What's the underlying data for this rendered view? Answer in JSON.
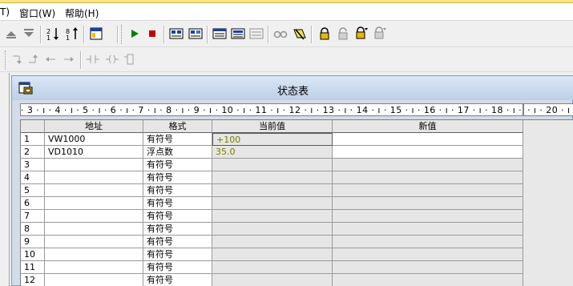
{
  "menu": {
    "items": [
      {
        "label": "T)"
      },
      {
        "label": "窗口(W)"
      },
      {
        "label": "帮助(H)"
      }
    ]
  },
  "status_window": {
    "title": "状态表",
    "ruler_text": "· 3 · ı · 4 · ı · 5 · ı · 6 · ı · 7 · ı · 8 · ı · 9 · ı · 10 · ı · 11 · ı · 12 · ı · 13 · ı · 14 · ı · 15 · ı · 16 · ı · 17 · ı · 18 · ı ·",
    "ruler_text_right": "· ı · 20 · ı",
    "columns": [
      "地址",
      "格式",
      "当前值",
      "新值"
    ],
    "rows": [
      {
        "num": "1",
        "address": "VW1000",
        "format": "有符号",
        "current": "+100",
        "new": ""
      },
      {
        "num": "2",
        "address": "VD1010",
        "format": "浮点数",
        "current": "35.0",
        "new": ""
      },
      {
        "num": "3",
        "address": "",
        "format": "有符号",
        "current": "",
        "new": ""
      },
      {
        "num": "4",
        "address": "",
        "format": "有符号",
        "current": "",
        "new": ""
      },
      {
        "num": "5",
        "address": "",
        "format": "有符号",
        "current": "",
        "new": ""
      },
      {
        "num": "6",
        "address": "",
        "format": "有符号",
        "current": "",
        "new": ""
      },
      {
        "num": "7",
        "address": "",
        "format": "有符号",
        "current": "",
        "new": ""
      },
      {
        "num": "8",
        "address": "",
        "format": "有符号",
        "current": "",
        "new": ""
      },
      {
        "num": "9",
        "address": "",
        "format": "有符号",
        "current": "",
        "new": ""
      },
      {
        "num": "10",
        "address": "",
        "format": "有符号",
        "current": "",
        "new": ""
      },
      {
        "num": "11",
        "address": "",
        "format": "有符号",
        "current": "",
        "new": ""
      },
      {
        "num": "12",
        "address": "",
        "format": "有符号",
        "current": "",
        "new": ""
      }
    ]
  },
  "toolbar_icons": [
    "scroll-up-icon",
    "scroll-down-icon",
    "sort-ascending-icon",
    "sort-descending-icon",
    "insert-status-chart-icon",
    "run-icon",
    "stop-icon",
    "program-status-icon",
    "chart-status-icon",
    "single-read-icon",
    "write-all-icon",
    "force-icon",
    "trend-view-icon",
    "pause-trend-icon",
    "glasses-icon",
    "read-all-forced-icon",
    "lock-icon",
    "unlock-icon",
    "unforce-all-icon",
    "read-forced-icon"
  ],
  "colors": {
    "value_text": "#7a7a00",
    "grey_cell": "#e6e6e6",
    "title_gradient": "#bcd0e8"
  }
}
